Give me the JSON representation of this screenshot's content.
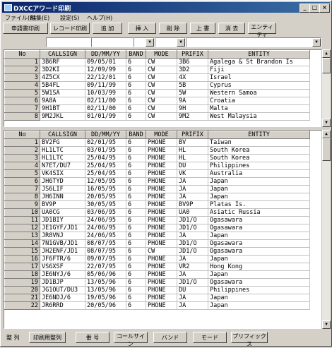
{
  "window": {
    "title": "DXCCアワード印刷"
  },
  "menu": [
    "ファイル(F)",
    "編集(E)",
    "設定(S)",
    "ヘルプ(H)"
  ],
  "toolbar": [
    "申請書印刷",
    "レコード印刷",
    "追 加",
    "挿 入",
    "削 除",
    "上 書",
    "消 去",
    "エンティティ"
  ],
  "upper_grid": {
    "headers": [
      "No",
      "CALLSIGN",
      "DD/MM/YY",
      "BAND",
      "MODE",
      "PRIFIX",
      "ENTITY"
    ],
    "rows": [
      [
        "1",
        "3B6RF",
        "09/05/01",
        "6",
        "CW",
        "3B6",
        "Agalega & St Brandon Is"
      ],
      [
        "2",
        "3D2KI",
        "12/09/99",
        "6",
        "CW",
        "3D2",
        "Fiji"
      ],
      [
        "3",
        "4Z5CX",
        "22/12/01",
        "6",
        "CW",
        "4X",
        "Israel"
      ],
      [
        "4",
        "5B4FL",
        "09/11/99",
        "6",
        "CW",
        "5B",
        "Cyprus"
      ],
      [
        "5",
        "5W1SA",
        "10/03/99",
        "6",
        "CW",
        "5W",
        "Western Samoa"
      ],
      [
        "6",
        "9A8A",
        "02/11/00",
        "6",
        "CW",
        "9A",
        "Croatia"
      ],
      [
        "7",
        "9H1BT",
        "02/11/00",
        "6",
        "CW",
        "9H",
        "Malta"
      ],
      [
        "8",
        "9M2JKL",
        "01/01/99",
        "6",
        "CW",
        "9M2",
        "West Malaysia"
      ]
    ]
  },
  "lower_grid": {
    "headers": [
      "No",
      "CALLSIGN",
      "DD/MM/YY",
      "BAND",
      "MODE",
      "PRIFIX",
      "ENTITY"
    ],
    "rows": [
      [
        "1",
        "BV2FG",
        "02/01/95",
        "6",
        "PHONE",
        "BV",
        "Taiwan"
      ],
      [
        "2",
        "HL1LTC",
        "03/01/95",
        "6",
        "PHONE",
        "HL",
        "South Korea"
      ],
      [
        "3",
        "HL1LTC",
        "25/04/95",
        "6",
        "PHONE",
        "HL",
        "South Korea"
      ],
      [
        "4",
        "N7ET/DU7",
        "25/04/95",
        "6",
        "PHONE",
        "DU",
        "Philippines"
      ],
      [
        "5",
        "VK4SIX",
        "25/04/95",
        "6",
        "PHONE",
        "VK",
        "Australia"
      ],
      [
        "6",
        "JH6TYD",
        "12/05/95",
        "6",
        "PHONE",
        "JA",
        "Japan"
      ],
      [
        "7",
        "JS6LIF",
        "16/05/95",
        "6",
        "PHONE",
        "JA",
        "Japan"
      ],
      [
        "8",
        "JH6INN",
        "20/05/95",
        "6",
        "PHONE",
        "JA",
        "Japan"
      ],
      [
        "9",
        "BV9P",
        "30/05/95",
        "6",
        "PHONE",
        "BV9P",
        "Platas Is."
      ],
      [
        "10",
        "UA0CG",
        "03/06/95",
        "6",
        "PHONE",
        "UA0",
        "Asiatic Russia"
      ],
      [
        "11",
        "JD1BIY",
        "24/06/95",
        "6",
        "PHONE",
        "JD1/O",
        "Ogasawara"
      ],
      [
        "12",
        "JE1GYF/JD1",
        "24/06/95",
        "6",
        "PHONE",
        "JD1/O",
        "Ogasawara"
      ],
      [
        "13",
        "JR8VNJ",
        "24/06/95",
        "6",
        "PHONE",
        "JA",
        "Japan"
      ],
      [
        "14",
        "7N1GVB/JD1",
        "08/07/95",
        "6",
        "PHONE",
        "JD1/O",
        "Ogasawara"
      ],
      [
        "15",
        "JH2ENF/JD1",
        "08/07/95",
        "6",
        "CW",
        "JD1/O",
        "Ogasawara"
      ],
      [
        "16",
        "JF6FTR/6",
        "09/07/95",
        "6",
        "PHONE",
        "JA",
        "Japan"
      ],
      [
        "17",
        "VS6XSF",
        "22/07/95",
        "6",
        "PHONE",
        "VR2",
        "Hong Kong"
      ],
      [
        "18",
        "JE6NYJ/6",
        "05/06/96",
        "6",
        "PHONE",
        "JA",
        "Japan"
      ],
      [
        "19",
        "JD1BJP",
        "13/05/96",
        "6",
        "PHONE",
        "JD1/O",
        "Ogasawara"
      ],
      [
        "20",
        "JG1OUT/DU3",
        "13/05/96",
        "6",
        "PHONE",
        "DU",
        "Philippines"
      ],
      [
        "21",
        "JE6NDJ/6",
        "19/05/96",
        "6",
        "PHONE",
        "JA",
        "Japan"
      ],
      [
        "22",
        "JR6RRD",
        "20/05/96",
        "6",
        "PHONE",
        "JA",
        "Japan"
      ]
    ]
  },
  "bottom": {
    "label": "整 列",
    "buttons": [
      "印刷用整列",
      "番 号",
      "コールサイン",
      "バンド",
      "モード",
      "プリフィックス"
    ]
  }
}
